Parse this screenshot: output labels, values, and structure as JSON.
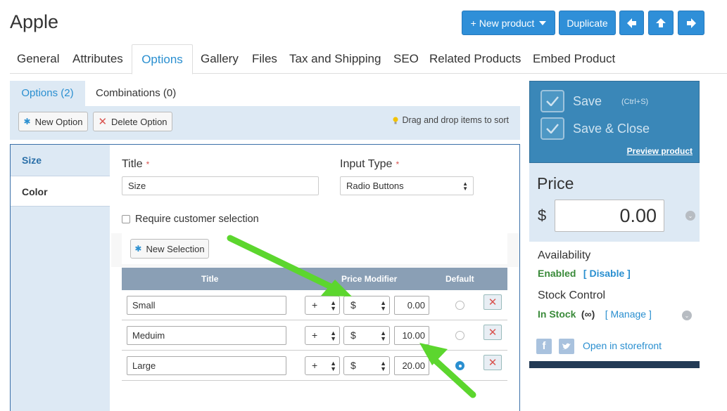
{
  "header": {
    "title": "Apple",
    "new_product_label": "+ New product",
    "duplicate_label": "Duplicate"
  },
  "main_tabs": [
    "General",
    "Attributes",
    "Options",
    "Gallery",
    "Files",
    "Tax and Shipping",
    "SEO",
    "Related Products",
    "Embed Product"
  ],
  "options_panel": {
    "sub_tabs": [
      "Options (2)",
      "Combinations (0)"
    ],
    "new_option_label": "New Option",
    "delete_option_label": "Delete Option",
    "hint": "Drag and drop items to sort",
    "option_list": [
      "Size",
      "Color"
    ],
    "title_label": "Title",
    "title_value": "Size",
    "input_type_label": "Input Type",
    "input_type_value": "Radio Buttons",
    "require_label": "Require customer selection",
    "new_selection_label": "New Selection",
    "table": {
      "headers": [
        "Title",
        "Price Modifier",
        "Default"
      ],
      "rows": [
        {
          "title": "Small",
          "sign": "+",
          "currency": "$",
          "value": "0.00",
          "default": false
        },
        {
          "title": "Meduim",
          "sign": "+",
          "currency": "$",
          "value": "10.00",
          "default": false
        },
        {
          "title": "Large",
          "sign": "+",
          "currency": "$",
          "value": "20.00",
          "default": true
        }
      ]
    }
  },
  "right_panel": {
    "save_label": "Save",
    "save_shortcut": "(Ctrl+S)",
    "save_close_label": "Save & Close",
    "preview_label": "Preview product",
    "price_label": "Price",
    "currency_symbol": "$",
    "price_value": "0.00",
    "availability_label": "Availability",
    "availability_status": "Enabled",
    "disable_link": "[ Disable ]",
    "stock_label": "Stock Control",
    "stock_status": "In Stock",
    "stock_infinity": "(∞)",
    "manage_link": "[ Manage ]",
    "storefront_link": "Open in storefront"
  },
  "colors": {
    "primary": "#2f8fd8",
    "accent_text": "#2a8fd0",
    "panel_bg": "#dde9f4",
    "save_panel": "#3a87b8",
    "table_header": "#8a9fb5",
    "enabled_green": "#3a8a3a",
    "annotation_arrow": "#5cd62e"
  }
}
